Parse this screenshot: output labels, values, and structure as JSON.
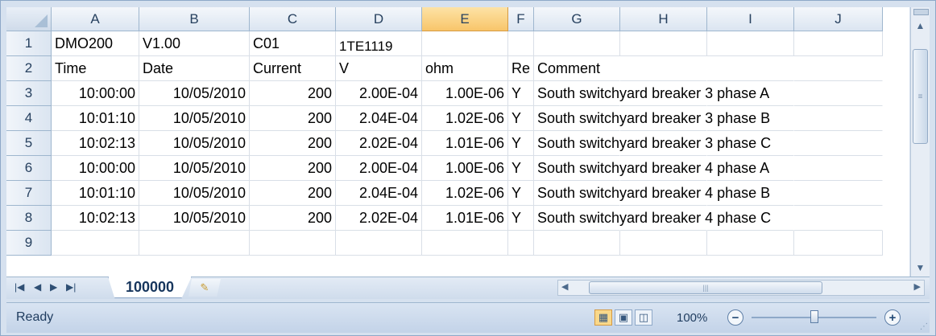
{
  "columns": [
    "A",
    "B",
    "C",
    "D",
    "E",
    "F",
    "G",
    "H",
    "I",
    "J"
  ],
  "selected_column": "E",
  "rows": [
    {
      "num": "1",
      "cells": [
        "DMO200",
        "V1.00",
        "C01",
        "1TE1119",
        "",
        "",
        "",
        "",
        "",
        ""
      ]
    },
    {
      "num": "2",
      "cells": [
        "Time",
        "Date",
        "Current",
        "V",
        "ohm",
        "Re",
        "Comment",
        "",
        "",
        ""
      ]
    },
    {
      "num": "3",
      "cells": [
        "10:00:00",
        "10/05/2010",
        "200",
        "2.00E-04",
        "1.00E-06",
        "Y",
        "South switchyard breaker 3 phase A",
        "",
        "",
        ""
      ]
    },
    {
      "num": "4",
      "cells": [
        "10:01:10",
        "10/05/2010",
        "200",
        "2.04E-04",
        "1.02E-06",
        "Y",
        "South switchyard breaker 3 phase B",
        "",
        "",
        ""
      ]
    },
    {
      "num": "5",
      "cells": [
        "10:02:13",
        "10/05/2010",
        "200",
        "2.02E-04",
        "1.01E-06",
        "Y",
        "South switchyard breaker 3 phase C",
        "",
        "",
        ""
      ]
    },
    {
      "num": "6",
      "cells": [
        "10:00:00",
        "10/05/2010",
        "200",
        "2.00E-04",
        "1.00E-06",
        "Y",
        "South switchyard breaker 4 phase A",
        "",
        "",
        ""
      ]
    },
    {
      "num": "7",
      "cells": [
        "10:01:10",
        "10/05/2010",
        "200",
        "2.04E-04",
        "1.02E-06",
        "Y",
        "South switchyard breaker 4 phase B",
        "",
        "",
        ""
      ]
    },
    {
      "num": "8",
      "cells": [
        "10:02:13",
        "10/05/2010",
        "200",
        "2.02E-04",
        "1.01E-06",
        "Y",
        "South switchyard breaker 4 phase C",
        "",
        "",
        ""
      ]
    },
    {
      "num": "9",
      "cells": [
        "",
        "",
        "",
        "",
        "",
        "",
        "",
        "",
        "",
        ""
      ]
    }
  ],
  "sheet_tab": {
    "label": "100000"
  },
  "status": {
    "text": "Ready",
    "zoom": "100%"
  },
  "icons": {
    "first_sheet": "first-sheet-icon",
    "prev_sheet": "prev-sheet-icon",
    "next_sheet": "next-sheet-icon",
    "last_sheet": "last-sheet-icon",
    "insert_sheet": "insert-sheet-icon",
    "normal_view": "normal-view-icon",
    "page_layout": "page-layout-icon",
    "page_break": "page-break-preview-icon",
    "zoom_out": "zoom-out-icon",
    "zoom_in": "zoom-in-icon"
  },
  "colors": {
    "selected_header": "#f8c56a",
    "sheet_tab_text": "#17365d"
  }
}
